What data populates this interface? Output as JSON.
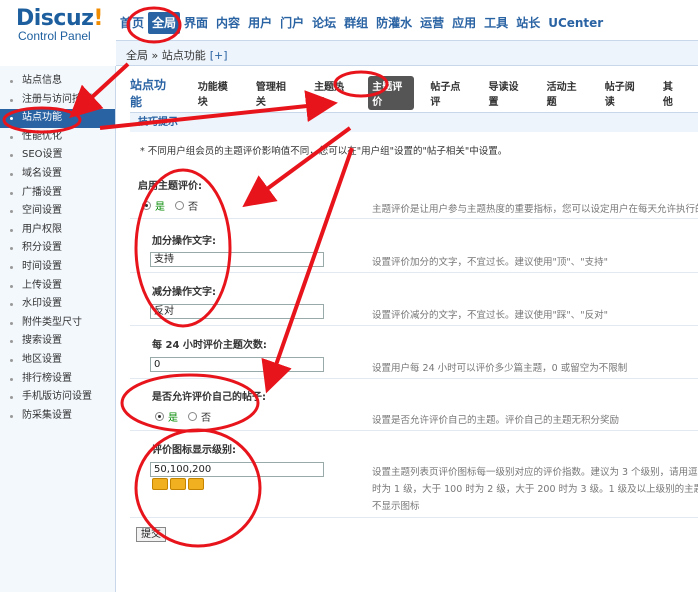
{
  "logo": {
    "main": "Discuz",
    "bang": "!",
    "sub": "Control Panel"
  },
  "topnav": [
    "首页",
    "全局",
    "界面",
    "内容",
    "用户",
    "门户",
    "论坛",
    "群组",
    "防灌水",
    "运营",
    "应用",
    "工具",
    "站长",
    "UCenter"
  ],
  "breadcrumb": {
    "text": "全局 » 站点功能",
    "plus": "[+]"
  },
  "sidebar": [
    "站点信息",
    "注册与访问控制",
    "站点功能",
    "性能优化",
    "SEO设置",
    "域名设置",
    "广播设置",
    "空间设置",
    "用户权限",
    "积分设置",
    "时间设置",
    "上传设置",
    "水印设置",
    "附件类型尺寸",
    "搜索设置",
    "地区设置",
    "排行榜设置",
    "手机版访问设置",
    "防采集设置"
  ],
  "tabs": {
    "section_title": "站点功能",
    "items": [
      "功能模块",
      "管理相关",
      "主题热度",
      "主题评价",
      "帖子点评",
      "导读设置",
      "活动主题",
      "帖子阅读",
      "其他"
    ]
  },
  "tips": {
    "title": "技巧提示",
    "text": "不同用户组会员的主题评价影响值不同，您可以在\"用户组\"设置的\"帖子相关\"中设置。"
  },
  "form": {
    "enable_label": "启用主题评价:",
    "yes": "是",
    "no": "否",
    "enable_desc": "主题评价是让用户参与主题热度的重要指标，您可以设定用户在每天允许执行的评价",
    "add_label": "加分操作文字:",
    "add_value": "支持",
    "add_desc": "设置评价加分的文字，不宜过长。建议使用\"顶\"、\"支持\"",
    "sub_label": "减分操作文字:",
    "sub_value": "反对",
    "sub_desc": "设置评价减分的文字，不宜过长。建议使用\"踩\"、\"反对\"",
    "count_label": "每 24 小时评价主题次数:",
    "count_value": "0",
    "count_desc": "设置用户每 24 小时可以评价多少篇主题，0 或留空为不限制",
    "self_label": "是否允许评价自己的帖子:",
    "self_desc": "设置是否允许评价自己的主题。评价自己的主题无积分奖励",
    "icon_label": "评价图标显示级别:",
    "icon_value": "50,100,200",
    "icon_desc1": "设置主题列表页评价图标每一级别对应的评价指数。建议为 3 个级别，请用逗号分",
    "icon_desc2": "时为 1 级，大于 100 时为 2 级，大于 200 时为 3 级。1 级及以上级别的主题会",
    "icon_desc3": "不显示图标",
    "submit": "提交"
  },
  "colors": {
    "accent": "#2a63a3",
    "annotation": "#e8141c"
  }
}
